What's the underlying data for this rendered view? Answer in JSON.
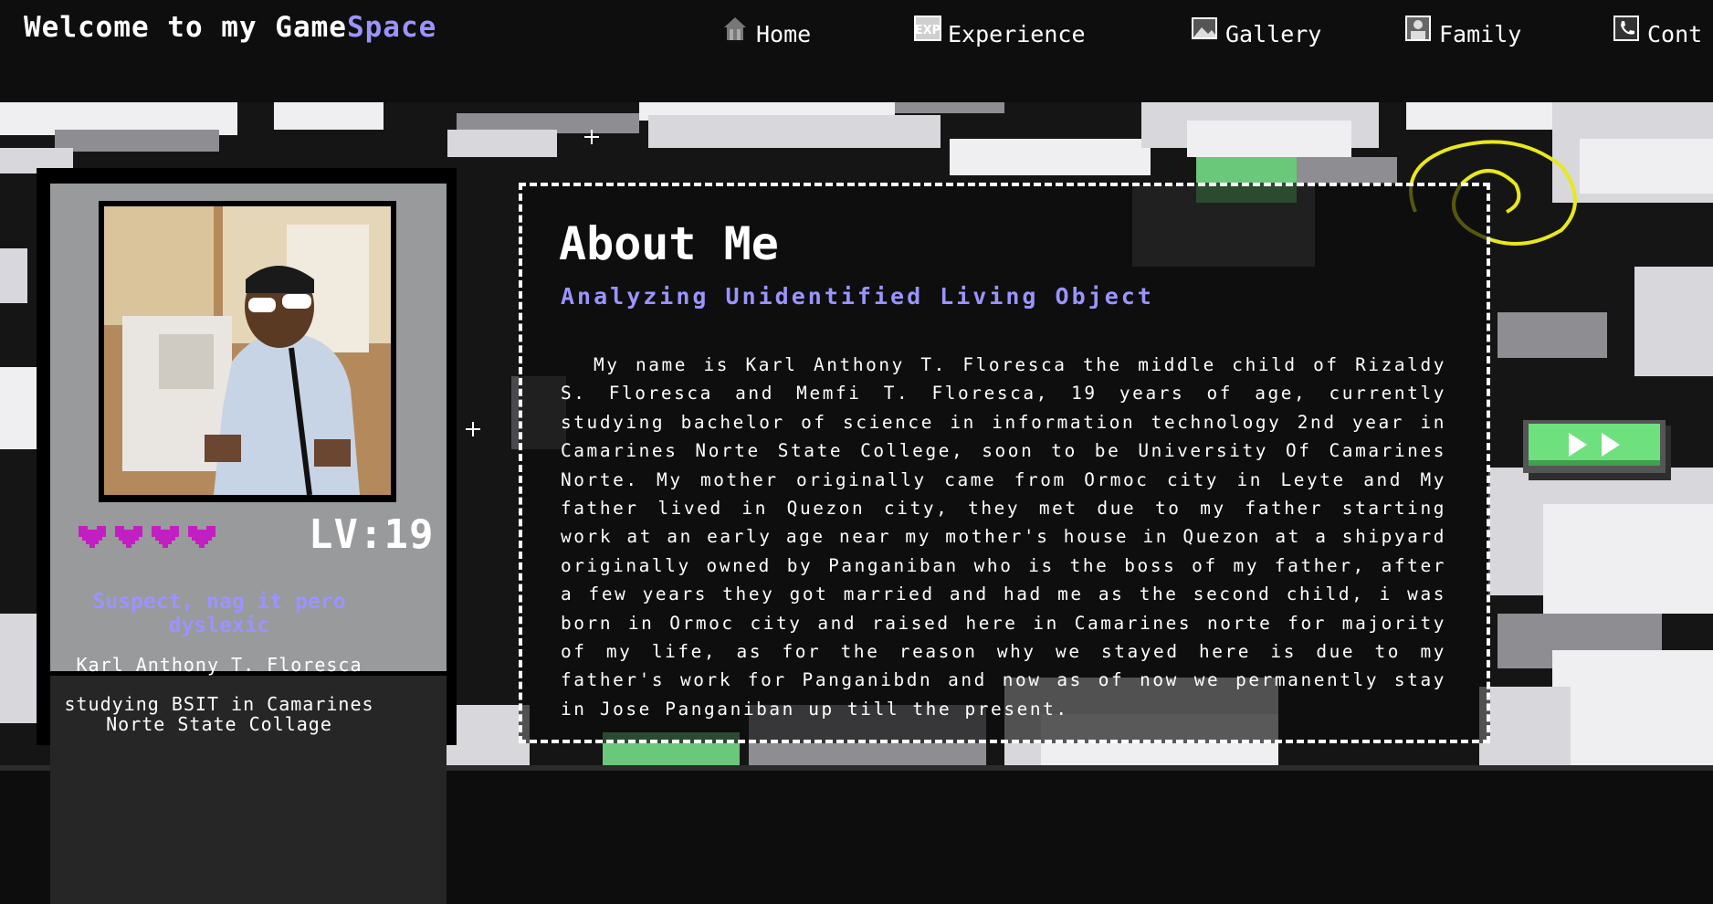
{
  "header": {
    "title_main": "Welcome to my Game",
    "title_accent": "Space",
    "nav": [
      {
        "label": "Home",
        "icon": "home-icon"
      },
      {
        "label": "Experience",
        "icon": "exp-icon"
      },
      {
        "label": "Gallery",
        "icon": "gallery-icon"
      },
      {
        "label": "Family",
        "icon": "family-icon"
      },
      {
        "label": "Cont",
        "icon": "phone-icon"
      }
    ]
  },
  "profile": {
    "photo": "profile-photo",
    "hearts": 4,
    "level": "LV:19",
    "status": "Suspect, nag it pero dyslexic",
    "name": "Karl Anthony T. Floresca",
    "education": "studying BSIT in Camarines Norte State Collage"
  },
  "about": {
    "title": "About Me",
    "subtitle": "Analyzing Unidentified Living Object",
    "body": "My name is Karl Anthony T. Floresca the middle child of Rizaldy S. Floresca and Memfi T. Floresca, 19 years of age, currently studying bachelor of science in information technology 2nd year in Camarines Norte State College, soon to be University Of Camarines Norte. My mother originally came from Ormoc city in Leyte and My father lived in Quezon city, they met due to my father starting work at an early age near my mother's house in Quezon at a shipyard originally owned by Panganiban who is the boss of my father, after a few years they got married and had me as the second child, i was born in Ormoc city and raised here in Camarines norte for majority of my life, as for the reason why we stayed here is due to my father's work for Panganibdn and now as of now we permanently stay in Jose Panganiban up till the present."
  },
  "colors": {
    "accent": "#9b94ff",
    "heart": "#c21fc2",
    "next_button": "#6fe07e"
  },
  "next_button": {
    "icon": "double-arrow-right-icon"
  }
}
